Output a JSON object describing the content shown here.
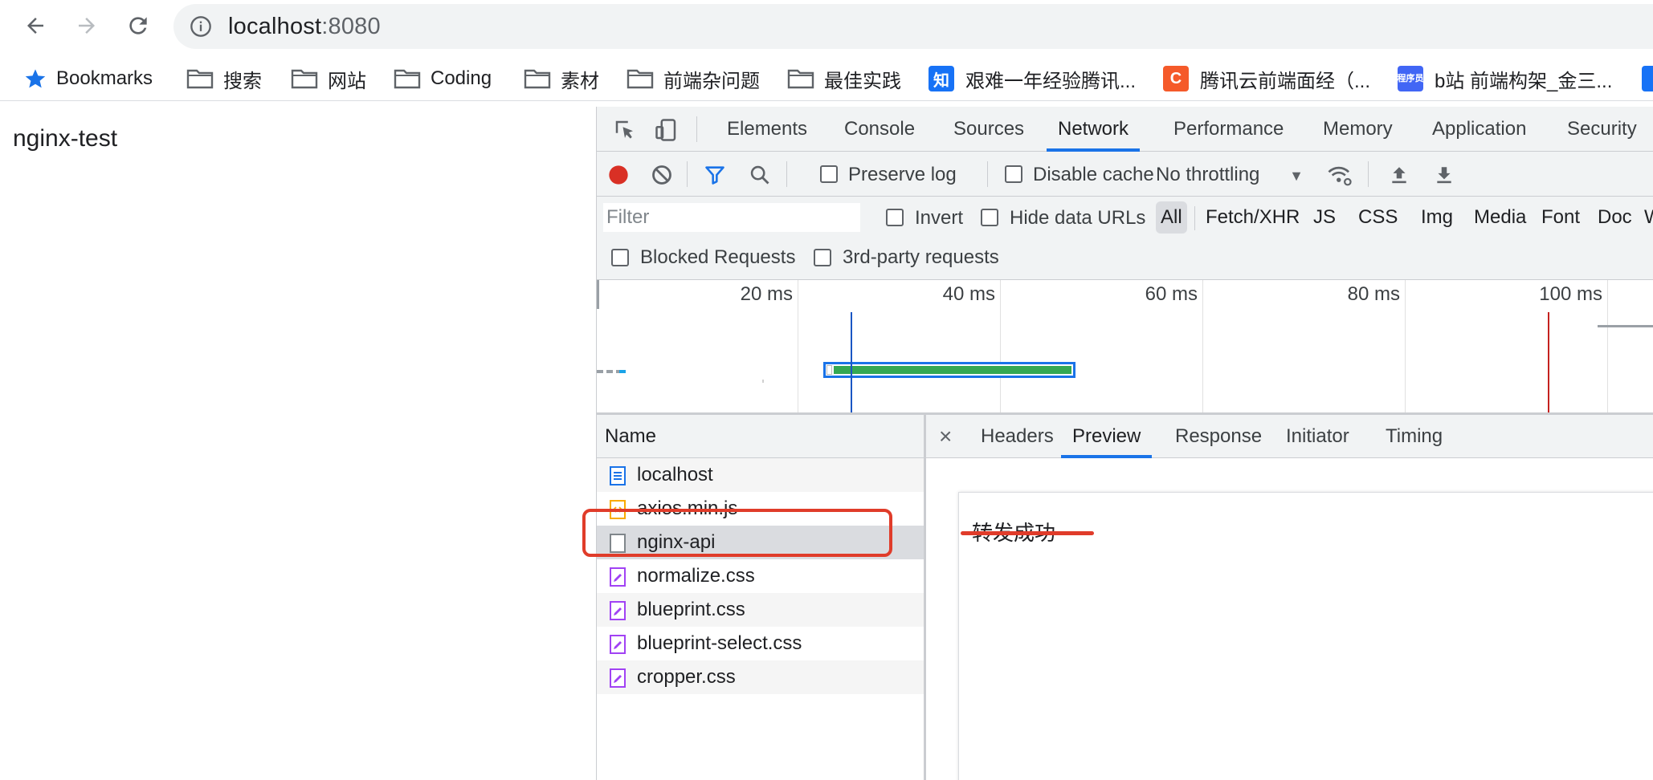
{
  "browser": {
    "url_host": "localhost",
    "url_port": ":8080",
    "bookmarks": [
      {
        "label": "Bookmarks",
        "icon": "star-icon"
      },
      {
        "label": "搜索",
        "icon": "folder-icon"
      },
      {
        "label": "网站",
        "icon": "folder-icon"
      },
      {
        "label": "Coding",
        "icon": "folder-icon"
      },
      {
        "label": "素材",
        "icon": "folder-icon"
      },
      {
        "label": "前端杂问题",
        "icon": "folder-icon"
      },
      {
        "label": "最佳实践",
        "icon": "folder-icon"
      },
      {
        "label": "艰难一年经验腾讯...",
        "icon": "zhihu-icon",
        "badge": "知",
        "color": "#1772f6"
      },
      {
        "label": "腾讯云前端面经（...",
        "icon": "c-icon",
        "badge": "C",
        "color": "#f55a2a"
      },
      {
        "label": "b站 前端构架_金三...",
        "icon": "chengxuyuan-icon",
        "badge": "程序员",
        "color": "#4166f5"
      }
    ]
  },
  "page": {
    "title": "nginx-test"
  },
  "devtools": {
    "tabs": [
      "Elements",
      "Console",
      "Sources",
      "Network",
      "Performance",
      "Memory",
      "Application",
      "Security"
    ],
    "active_tab": "Network",
    "toolbar": {
      "preserve_log": "Preserve log",
      "disable_cache": "Disable cache",
      "throttling": "No throttling"
    },
    "filter": {
      "placeholder": "Filter",
      "invert": "Invert",
      "hide_data_urls": "Hide data URLs",
      "types": [
        "All",
        "Fetch/XHR",
        "JS",
        "CSS",
        "Img",
        "Media",
        "Font",
        "Doc",
        "WS"
      ],
      "active_type": "All",
      "blocked_requests": "Blocked Requests",
      "third_party": "3rd-party requests"
    },
    "overview": {
      "ticks": [
        "20 ms",
        "40 ms",
        "60 ms",
        "80 ms",
        "100 ms"
      ]
    },
    "requests": {
      "header": "Name",
      "rows": [
        {
          "name": "localhost",
          "type": "document"
        },
        {
          "name": "axios.min.js",
          "type": "script"
        },
        {
          "name": "nginx-api",
          "type": "fetch",
          "selected": true
        },
        {
          "name": "normalize.css",
          "type": "stylesheet"
        },
        {
          "name": "blueprint.css",
          "type": "stylesheet"
        },
        {
          "name": "blueprint-select.css",
          "type": "stylesheet"
        },
        {
          "name": "cropper.css",
          "type": "stylesheet"
        }
      ]
    },
    "detail": {
      "close": "×",
      "tabs": [
        "Headers",
        "Preview",
        "Response",
        "Initiator",
        "Timing"
      ],
      "active_tab": "Preview",
      "preview_text": "转发成功"
    }
  },
  "colors": {
    "accent": "#1a73e8",
    "annotation": "#e03c2a",
    "record": "#d93025"
  }
}
